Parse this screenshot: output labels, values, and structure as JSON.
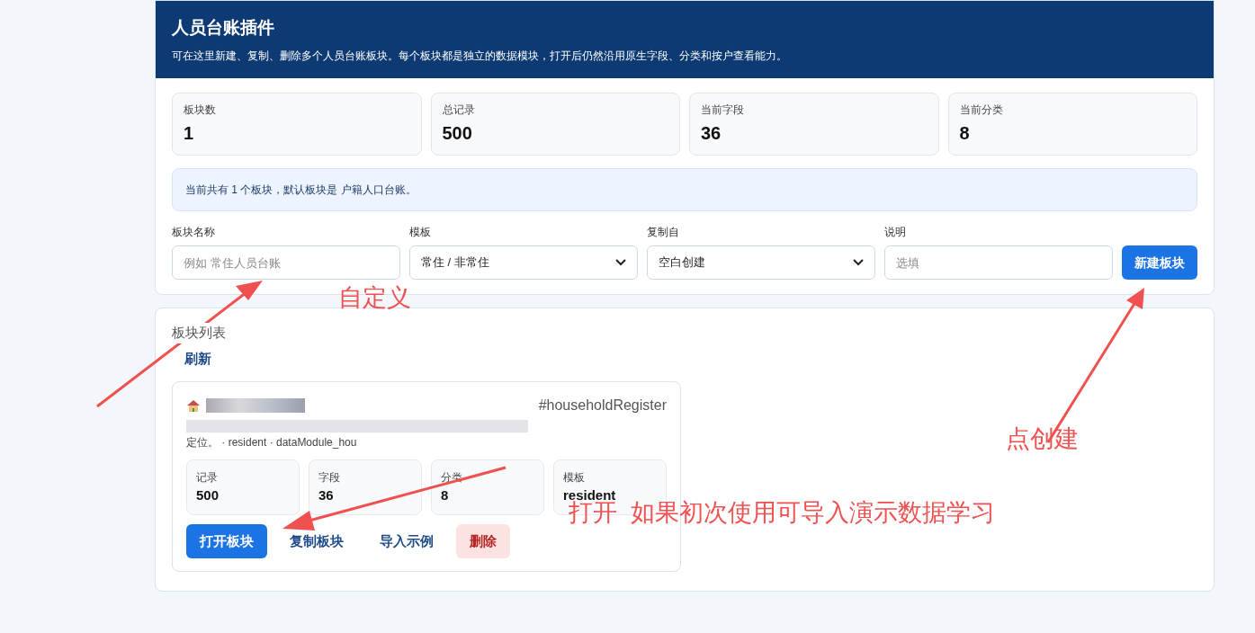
{
  "header": {
    "title": "人员台账插件",
    "subtitle": "可在这里新建、复制、删除多个人员台账板块。每个板块都是独立的数据模块，打开后仍然沿用原生字段、分类和按户查看能力。"
  },
  "stats": [
    {
      "label": "板块数",
      "value": "1"
    },
    {
      "label": "总记录",
      "value": "500"
    },
    {
      "label": "当前字段",
      "value": "36"
    },
    {
      "label": "当前分类",
      "value": "8"
    }
  ],
  "notice": "当前共有 1 个板块，默认板块是 户籍人口台账。",
  "form": {
    "fields": [
      {
        "kind": "input",
        "label": "板块名称",
        "placeholder": "例如 常住人员台账"
      },
      {
        "kind": "select",
        "label": "模板",
        "value": "常住 / 非常住"
      },
      {
        "kind": "select",
        "label": "复制自",
        "value": "空白创建"
      },
      {
        "kind": "input",
        "label": "说明",
        "placeholder": "选填"
      }
    ],
    "submit": "新建板块"
  },
  "list": {
    "title": "板块列表",
    "refresh": "刷新",
    "modules": [
      {
        "key": "#householdRegister",
        "description": "定位。 · resident · dataModule_hou",
        "stats": [
          {
            "label": "记录",
            "value": "500"
          },
          {
            "label": "字段",
            "value": "36"
          },
          {
            "label": "分类",
            "value": "8"
          },
          {
            "label": "模板",
            "value": "resident"
          }
        ],
        "actions": [
          {
            "kind": "primary",
            "label": "打开板块"
          },
          {
            "kind": "link",
            "label": "复制板块"
          },
          {
            "kind": "link",
            "label": "导入示例"
          },
          {
            "kind": "danger",
            "label": "删除"
          }
        ]
      }
    ]
  },
  "annotations": [
    {
      "text": "自定义"
    },
    {
      "text": "点创建"
    },
    {
      "text": "打开  如果初次使用可导入演示数据学习"
    }
  ]
}
